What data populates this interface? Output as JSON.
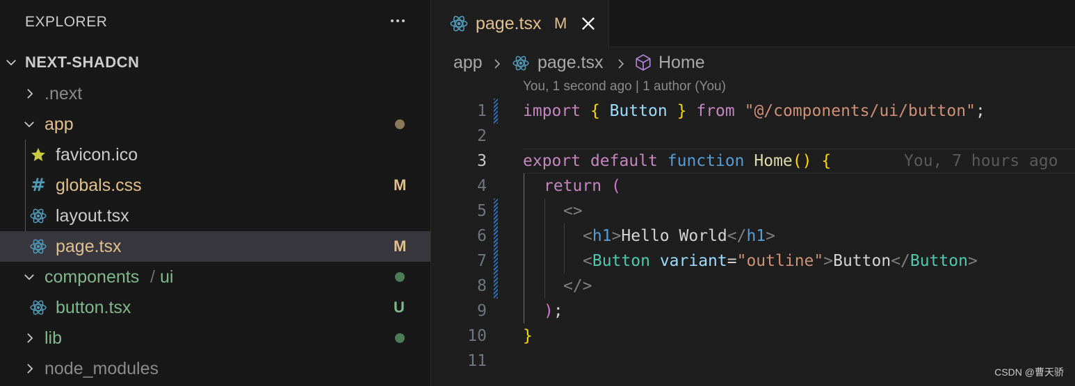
{
  "sidebar": {
    "title": "EXPLORER",
    "root": "NEXT-SHADCN",
    "items": [
      {
        "label": ".next",
        "color": "#8b8b8b",
        "badge": "",
        "badgeColor": ""
      },
      {
        "label": "app",
        "color": "#e2c08d",
        "badge": "",
        "badgeColor": ""
      },
      {
        "label": "favicon.ico",
        "color": "#cccccc",
        "badge": "",
        "badgeColor": ""
      },
      {
        "label": "globals.css",
        "color": "#e2c08d",
        "badge": "M",
        "badgeColor": "#e2c08d"
      },
      {
        "label": "layout.tsx",
        "color": "#cccccc",
        "badge": "",
        "badgeColor": ""
      },
      {
        "label": "page.tsx",
        "color": "#e2c08d",
        "badge": "M",
        "badgeColor": "#e2c08d"
      },
      {
        "label": "components",
        "color": "#81b88b",
        "badge": "",
        "badgeColor": ""
      },
      {
        "label": "/",
        "color": "#6e6e6e"
      },
      {
        "label": "ui",
        "color": "#81b88b"
      },
      {
        "label": "button.tsx",
        "color": "#81b88b",
        "badge": "U",
        "badgeColor": "#81b88b"
      },
      {
        "label": "lib",
        "color": "#81b88b",
        "badge": "",
        "badgeColor": ""
      },
      {
        "label": "node_modules",
        "color": "#8b8b8b",
        "badge": "",
        "badgeColor": ""
      }
    ]
  },
  "tab": {
    "label": "page.tsx",
    "badge": "M"
  },
  "breadcrumb": {
    "folder": "app",
    "file": "page.tsx",
    "symbol": "Home"
  },
  "blame": {
    "header": "You, 1 second ago | 1 author (You)",
    "inline": "You, 7 hours ago"
  },
  "code": {
    "line_numbers": [
      "1",
      "2",
      "3",
      "4",
      "5",
      "6",
      "7",
      "8",
      "9",
      "10",
      "11"
    ],
    "l1": {
      "import": "import",
      "ob": "{",
      "button": "Button",
      "cb": "}",
      "from": "from",
      "path": "\"@/components/ui/button\"",
      "semi": ";"
    },
    "l3": {
      "export": "export",
      "default": "default",
      "function": "function",
      "name": "Home",
      "parens": "()",
      "ob": "{"
    },
    "l4": {
      "return": "return",
      "paren": "("
    },
    "l5": {
      "frag": "<>"
    },
    "l6": {
      "lt": "<",
      "tag": "h1",
      "gt": ">",
      "text": "Hello World",
      "lt2": "</",
      "tag2": "h1",
      "gt2": ">"
    },
    "l7": {
      "lt": "<",
      "comp": "Button",
      "attr": "variant",
      "eq": "=",
      "val": "\"outline\"",
      "gt": ">",
      "text": "Button",
      "lt2": "</",
      "comp2": "Button",
      "gt2": ">"
    },
    "l8": {
      "frag": "</>"
    },
    "l9": {
      "paren": ")",
      "semi": ";"
    },
    "l10": {
      "cb": "}"
    }
  },
  "watermark": "CSDN @曹天骄",
  "colors": {
    "react": "#519aba",
    "star": "#cbcb41",
    "css": "#519aba",
    "symbol": "#b180d7"
  }
}
